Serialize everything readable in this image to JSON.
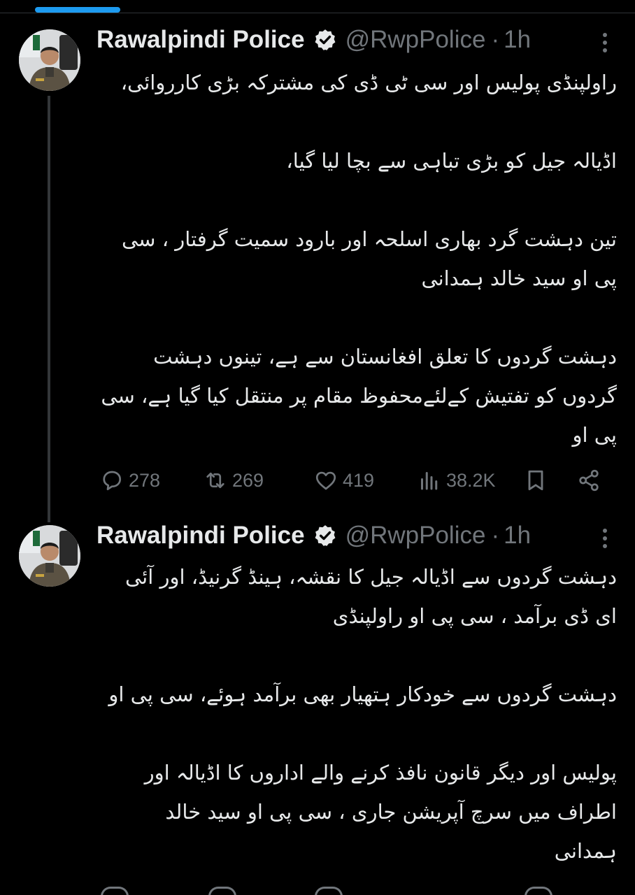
{
  "colors": {
    "background": "#000000",
    "text": "#e7e9ea",
    "secondary_text": "#71767b",
    "accent": "#1d9bf0",
    "verified_badge": "#e7e9ea"
  },
  "tweets": [
    {
      "author_name": "Rawalpindi Police",
      "verified_icon": "verified-badge-icon",
      "handle": "@RwpPolice",
      "separator": "·",
      "time": "1h",
      "paragraphs": [
        "راولپنڈی پولیس اور سی ٹی ڈی کی مشترکہ بڑی کارروائی،",
        "اڈیالہ جیل کو بڑی تباہی سے بچا لیا گیا،",
        "تین دہشت گرد بھاری اسلحہ اور بارود سمیت گرفتار ، سی پی او سید خالد ہمدانی",
        "دہشت گردوں کا تعلق افغانستان سے ہے، تینوں دہشت گردوں کو تفتیش کےلئےمحفوظ مقام پر منتقل کیا گیا ہے، سی پی او"
      ],
      "actions": {
        "replies": "278",
        "reposts": "269",
        "likes": "419",
        "views": "38.2K"
      }
    },
    {
      "author_name": "Rawalpindi Police",
      "verified_icon": "verified-badge-icon",
      "handle": "@RwpPolice",
      "separator": "·",
      "time": "1h",
      "paragraphs": [
        "دہشت گردوں سے اڈیالہ جیل کا نقشہ، ہینڈ گرنیڈ، اور آئی ای ڈی برآمد ، سی پی او راولپنڈی",
        "دہشت گردوں سے خودکار ہتھیار بھی برآمد ہوئے، سی پی او",
        "پولیس اور دیگر قانون نافذ کرنے والے اداروں کا اڈیالہ اور اطراف میں سرچ آپریشن جاری ، سی پی او سید خالد ہمدانی"
      ]
    }
  ]
}
